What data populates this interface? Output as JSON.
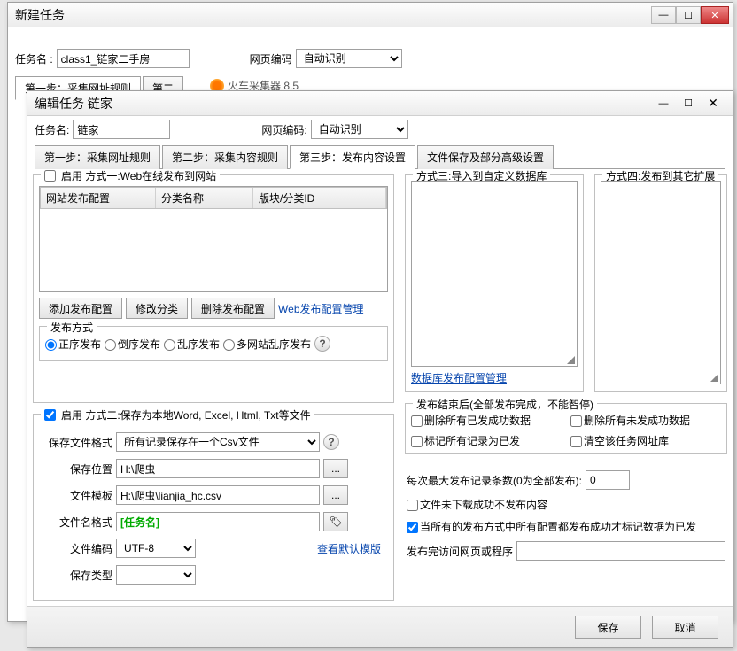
{
  "bgWindow": {
    "title": "新建任务",
    "taskNameLabel": "任务名 :",
    "taskNameValue": "class1_链家二手房",
    "encodingLabel": "网页编码",
    "encodingValue": "自动识别",
    "tabs": [
      "第一步：采集网址规则",
      "第二"
    ]
  },
  "topWinBtns": {
    "min": "—",
    "max": "☐",
    "close": "✕"
  },
  "appTitle": "火车采集器 8.5",
  "dialog": {
    "title": "编辑任务 链家",
    "winBtns": {
      "min": "—",
      "max": "☐",
      "close": "✕"
    },
    "taskNameLabel": "任务名:",
    "taskNameValue": "链家",
    "encodingLabel": "网页编码:",
    "encodingValue": "自动识别",
    "tabs": [
      "第一步：采集网址规则",
      "第二步：采集内容规则",
      "第三步：发布内容设置",
      "文件保存及部分高级设置"
    ],
    "method1": {
      "legend": "启用  方式一:Web在线发布到网站",
      "cols": [
        "网站发布配置",
        "分类名称",
        "版块/分类ID"
      ],
      "btnAdd": "添加发布配置",
      "btnMod": "修改分类",
      "btnDel": "删除发布配置",
      "linkMgr": "Web发布配置管理",
      "pubModeLabel": "发布方式",
      "radios": [
        "正序发布",
        "倒序发布",
        "乱序发布",
        "多网站乱序发布"
      ]
    },
    "method2": {
      "legend": "启用  方式二:保存为本地Word, Excel, Html, Txt等文件",
      "fileFormatLabel": "保存文件格式",
      "fileFormatValue": "所有记录保存在一个Csv文件",
      "savePathLabel": "保存位置",
      "savePathValue": "H:\\爬虫",
      "templateLabel": "文件模板",
      "templateValue": "H:\\爬虫\\lianjia_hc.csv",
      "nameFmtLabel": "文件名格式",
      "nameFmtValue": "[任务名]",
      "encLabel": "文件编码",
      "encValue": "UTF-8",
      "defaultLink": "查看默认模版",
      "saveTypeLabel": "保存类型"
    },
    "method3": {
      "legend": "方式三:导入到自定义数据库",
      "link": "数据库发布配置管理"
    },
    "method4": {
      "legend": "方式四:发布到其它扩展"
    },
    "afterPub": {
      "title": "发布结束后(全部发布完成，不能智停)",
      "c1": "删除所有已发成功数据",
      "c2": "删除所有未发成功数据",
      "c3": "标记所有记录为已发",
      "c4": "清空该任务网址库"
    },
    "maxRecLabel": "每次最大发布记录条数(0为全部发布):",
    "maxRecValue": "0",
    "chkNotDL": "文件未下载成功不发布内容",
    "chkAllCfg": "当所有的发布方式中所有配置都发布成功才标记数据为已发",
    "visitLabel": "发布完访问网页或程序",
    "btnSave": "保存",
    "btnCancel": "取消"
  }
}
